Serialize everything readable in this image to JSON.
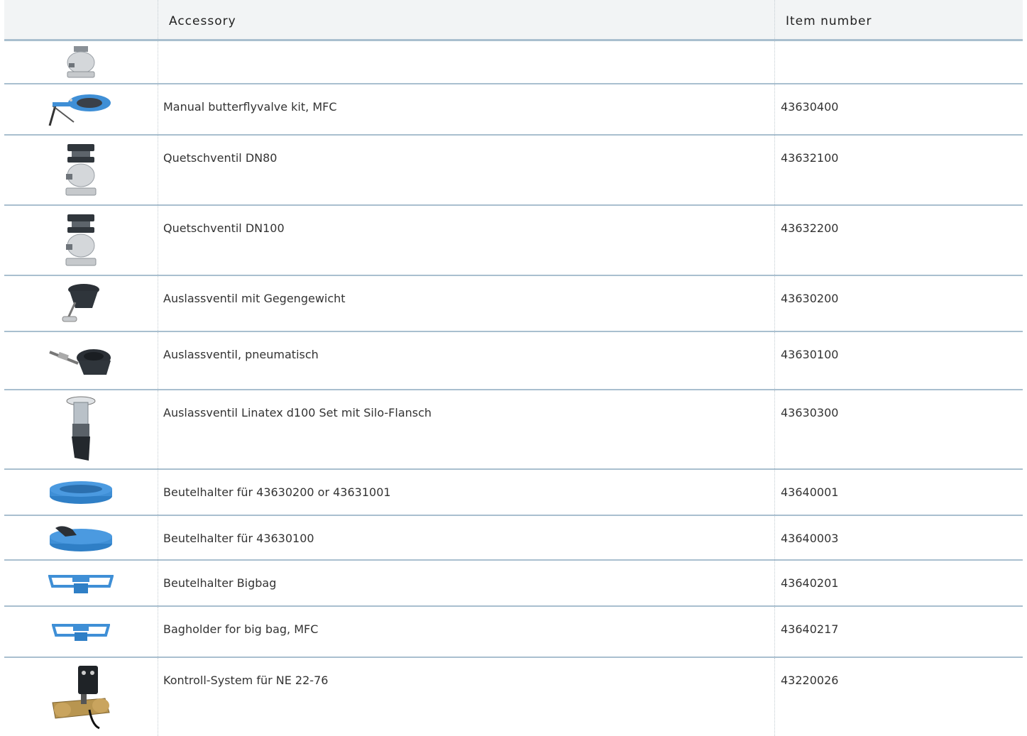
{
  "table": {
    "headers": {
      "image": "",
      "accessory": "Accessory",
      "item_number": "Item number"
    },
    "rows": [
      {
        "accessory": "",
        "item_number": "",
        "icon": "valve-bottom-partial-icon"
      },
      {
        "accessory": "Manual butterflyvalve kit, MFC",
        "item_number": "43630400",
        "icon": "butterfly-valve-icon"
      },
      {
        "accessory": "Quetschventil DN80",
        "item_number": "43632100",
        "icon": "pinch-valve-icon"
      },
      {
        "accessory": "Quetschventil DN100",
        "item_number": "43632200",
        "icon": "pinch-valve-icon"
      },
      {
        "accessory": "Auslassventil mit Gegengewicht",
        "item_number": "43630200",
        "icon": "counterweight-outlet-valve-icon"
      },
      {
        "accessory": "Auslassventil, pneumatisch",
        "item_number": "43630100",
        "icon": "pneumatic-outlet-valve-icon"
      },
      {
        "accessory": "Auslassventil Linatex d100 Set mit Silo-Flansch",
        "item_number": "43630300",
        "icon": "linatex-valve-icon"
      },
      {
        "accessory": "Beutelhalter für 43630200 or 43631001",
        "item_number": "43640001",
        "icon": "bag-holder-ring-icon"
      },
      {
        "accessory": "Beutelhalter für 43630100",
        "item_number": "43640003",
        "icon": "bag-holder-clamp-icon"
      },
      {
        "accessory": "Beutelhalter Bigbag",
        "item_number": "43640201",
        "icon": "bigbag-frame-icon"
      },
      {
        "accessory": "Bagholder for big bag, MFC",
        "item_number": "43640217",
        "icon": "bigbag-frame-small-icon"
      },
      {
        "accessory": "Kontroll-System für NE 22-76",
        "item_number": "43220026",
        "icon": "control-system-icon"
      }
    ]
  },
  "colors": {
    "header_bg": "#f2f4f5",
    "row_border": "#a9bfcf",
    "accent_blue": "#3f8fd6"
  }
}
